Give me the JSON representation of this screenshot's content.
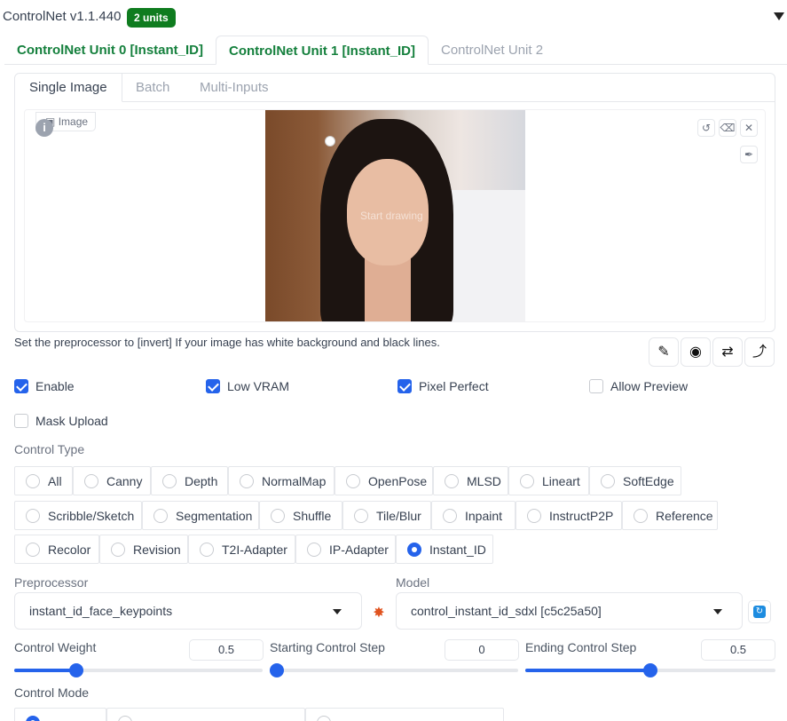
{
  "header": {
    "title": "ControlNet v1.1.440",
    "badge": "2 units"
  },
  "unit_tabs": [
    {
      "label": "ControlNet Unit 0 [Instant_ID]"
    },
    {
      "label": "ControlNet Unit 1 [Instant_ID]"
    },
    {
      "label": "ControlNet Unit 2"
    }
  ],
  "active_unit_tab": 1,
  "input_tabs": [
    {
      "label": "Single Image"
    },
    {
      "label": "Batch"
    },
    {
      "label": "Multi-Inputs"
    }
  ],
  "image_panel": {
    "label": "Image",
    "canvas_placeholder": "Start drawing",
    "toolbar_icons": [
      "undo-icon",
      "eraser-icon",
      "close-icon",
      "brush-icon"
    ]
  },
  "hint_text": "Set the preprocessor to [invert] If your image has white background and black lines.",
  "action_buttons": [
    "edit-icon",
    "camera-icon",
    "swap-icon",
    "send-icon"
  ],
  "checkboxes": [
    {
      "label": "Enable",
      "checked": true
    },
    {
      "label": "Low VRAM",
      "checked": true
    },
    {
      "label": "Pixel Perfect",
      "checked": true
    },
    {
      "label": "Allow Preview",
      "checked": false
    },
    {
      "label": "Mask Upload",
      "checked": false
    }
  ],
  "control_type": {
    "label": "Control Type",
    "options": [
      "All",
      "Canny",
      "Depth",
      "NormalMap",
      "OpenPose",
      "MLSD",
      "Lineart",
      "SoftEdge",
      "Scribble/Sketch",
      "Segmentation",
      "Shuffle",
      "Tile/Blur",
      "Inpaint",
      "InstructP2P",
      "Reference",
      "Recolor",
      "Revision",
      "T2I-Adapter",
      "IP-Adapter",
      "Instant_ID"
    ],
    "selected": "Instant_ID"
  },
  "preprocessor": {
    "label": "Preprocessor",
    "value": "instant_id_face_keypoints"
  },
  "model": {
    "label": "Model",
    "value": "control_instant_id_sdxl [c5c25a50]"
  },
  "sliders": [
    {
      "label": "Control Weight",
      "value": "0.5",
      "fraction": 0.25
    },
    {
      "label": "Starting Control Step",
      "value": "0",
      "fraction": 0.0
    },
    {
      "label": "Ending Control Step",
      "value": "0.5",
      "fraction": 0.5
    }
  ],
  "control_mode": {
    "label": "Control Mode"
  },
  "colors": {
    "accent": "#2563eb",
    "tab_green": "#15803d",
    "badge_green": "#0f7c1f"
  }
}
